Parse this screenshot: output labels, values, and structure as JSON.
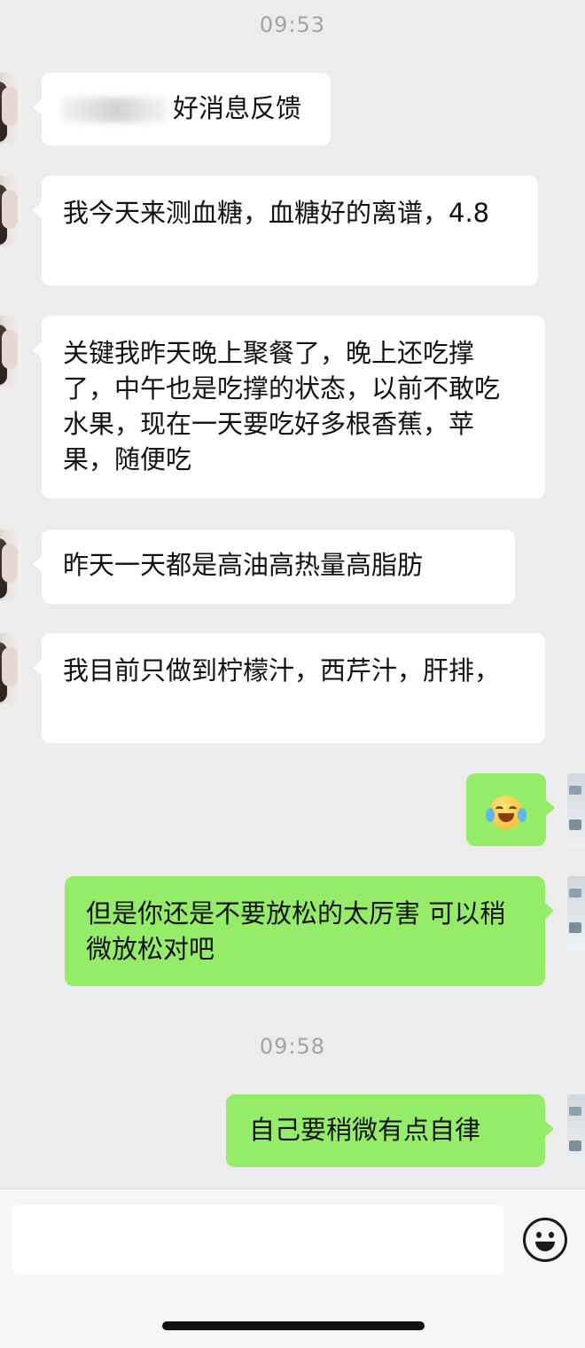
{
  "chat": {
    "timestamps": [
      "09:53",
      "09:58"
    ],
    "messages": [
      {
        "side": "in",
        "text": "好消息反馈"
      },
      {
        "side": "in",
        "text": "我今天来测血糖，血糖好的离谱，4.8"
      },
      {
        "side": "in",
        "text": "关键我昨天晚上聚餐了，晚上还吃撑了，中午也是吃撑的状态，以前不敢吃水果，现在一天要吃好多根香蕉，苹果，随便吃"
      },
      {
        "side": "in",
        "text": "昨天一天都是高油高热量高脂肪"
      },
      {
        "side": "in",
        "text": "我目前只做到柠檬汁，西芹汁，肝排，"
      },
      {
        "side": "out",
        "emoji": "crying-laughing-face"
      },
      {
        "side": "out",
        "text": "但是你还是不要放松的太厉害 可以稍微放松对吧"
      },
      {
        "side": "out",
        "text": "自己要稍微有点自律"
      }
    ]
  },
  "input_bar": {
    "placeholder": "",
    "emoji_icon": "smiley-icon"
  },
  "colors": {
    "background": "#ececec",
    "incoming_bubble": "#ffffff",
    "outgoing_bubble": "#95ec69",
    "timestamp": "#a3a3a3"
  }
}
